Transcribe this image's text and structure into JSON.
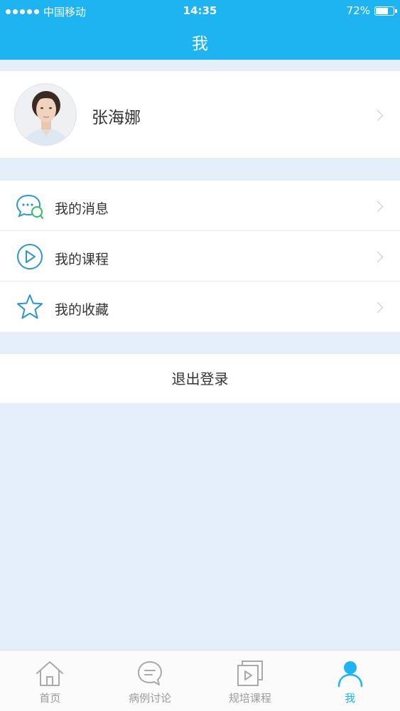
{
  "status_bar": {
    "carrier": "中国移动",
    "time": "14:35",
    "battery_text": "72%",
    "battery_level": 0.72
  },
  "header": {
    "title": "我"
  },
  "profile": {
    "name": "张海娜"
  },
  "menu": {
    "items": [
      {
        "label": "我的消息",
        "icon": "chat-bubbles-icon"
      },
      {
        "label": "我的课程",
        "icon": "play-circle-icon"
      },
      {
        "label": "我的收藏",
        "icon": "star-icon"
      }
    ]
  },
  "logout": {
    "label": "退出登录"
  },
  "tabbar": {
    "tabs": [
      {
        "label": "首页",
        "icon": "home-icon",
        "active": false
      },
      {
        "label": "病例讨论",
        "icon": "chat-icon",
        "active": false
      },
      {
        "label": "规培课程",
        "icon": "course-icon",
        "active": false
      },
      {
        "label": "我",
        "icon": "person-icon",
        "active": true
      }
    ]
  },
  "colors": {
    "primary": "#1eb4f2",
    "background": "#e5eefb",
    "text": "#333333",
    "tab_inactive": "#9a9a9a"
  }
}
